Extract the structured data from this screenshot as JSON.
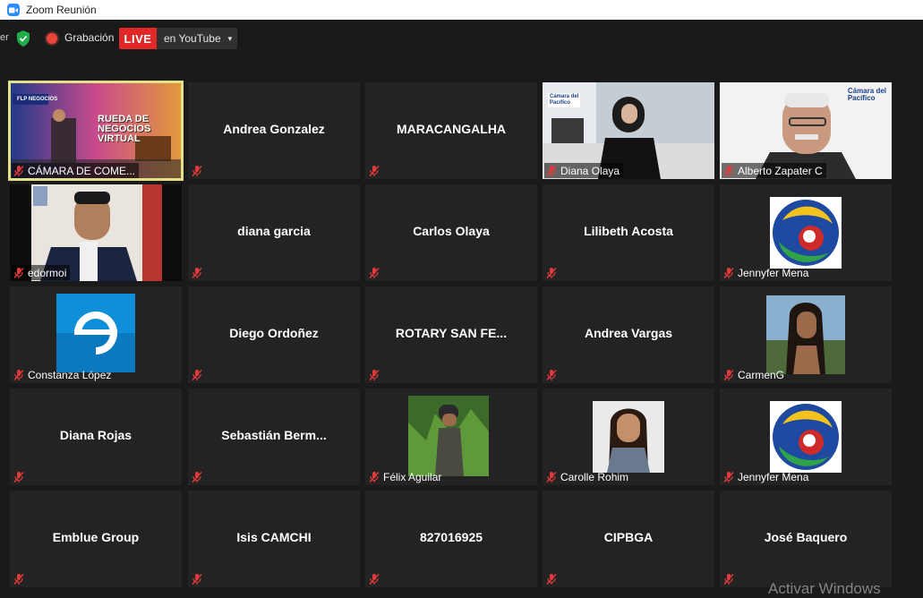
{
  "window": {
    "title": "Zoom Reunión"
  },
  "toolbar": {
    "edge_text": "er",
    "recording_label": "Grabación",
    "live_badge": "LIVE",
    "live_destination": "en YouTube",
    "caret": "▾"
  },
  "colors": {
    "accent": "#2d8cff",
    "live": "#e02828",
    "recording": "#e8463b",
    "active_border": "#e4e08a",
    "muted_mic": "#e03a3a"
  },
  "tiles": [
    {
      "label": "CÁMARA DE COME...",
      "video": true,
      "active": true
    },
    {
      "center": "Andrea Gonzalez"
    },
    {
      "center": "MARACANGALHA"
    },
    {
      "label": "Diana Olaya",
      "video": true
    },
    {
      "label": "Alberto Zapater C",
      "video": true
    },
    {
      "label": "edormoi",
      "video": true
    },
    {
      "center": "diana garcia"
    },
    {
      "center": "Carlos Olaya"
    },
    {
      "center": "Lilibeth Acosta"
    },
    {
      "label": "Jennyfer Mena",
      "avatar": "logo"
    },
    {
      "label": "Constanza López",
      "avatar": "e-logo"
    },
    {
      "center": "Diego Ordoñez"
    },
    {
      "center": "ROTARY SAN FE..."
    },
    {
      "center": "Andrea Vargas"
    },
    {
      "label": "CarmenG",
      "avatar": "photo"
    },
    {
      "center": "Diana Rojas"
    },
    {
      "center": "Sebastián  Berm..."
    },
    {
      "label": "Félix Aguilar",
      "avatar": "photo"
    },
    {
      "label": "Carolle Rohim",
      "avatar": "photo"
    },
    {
      "label": "Jennyfer Mena",
      "avatar": "logo"
    },
    {
      "center": "Emblue Group"
    },
    {
      "center": "Isis CAMCHI"
    },
    {
      "center": "827016925"
    },
    {
      "center": "CIPBGA"
    },
    {
      "center": "José Baquero"
    }
  ],
  "camara_logo": {
    "line1": "Cámara",
    "line2": "Pacífico",
    "del": "del"
  },
  "video_overlay": {
    "brand": "FLP NEGOCIOS",
    "line1": "RUEDA DE",
    "line2": "NEGOCIOS",
    "line3": "VIRTUAL"
  },
  "watermark": "Activar Windows"
}
